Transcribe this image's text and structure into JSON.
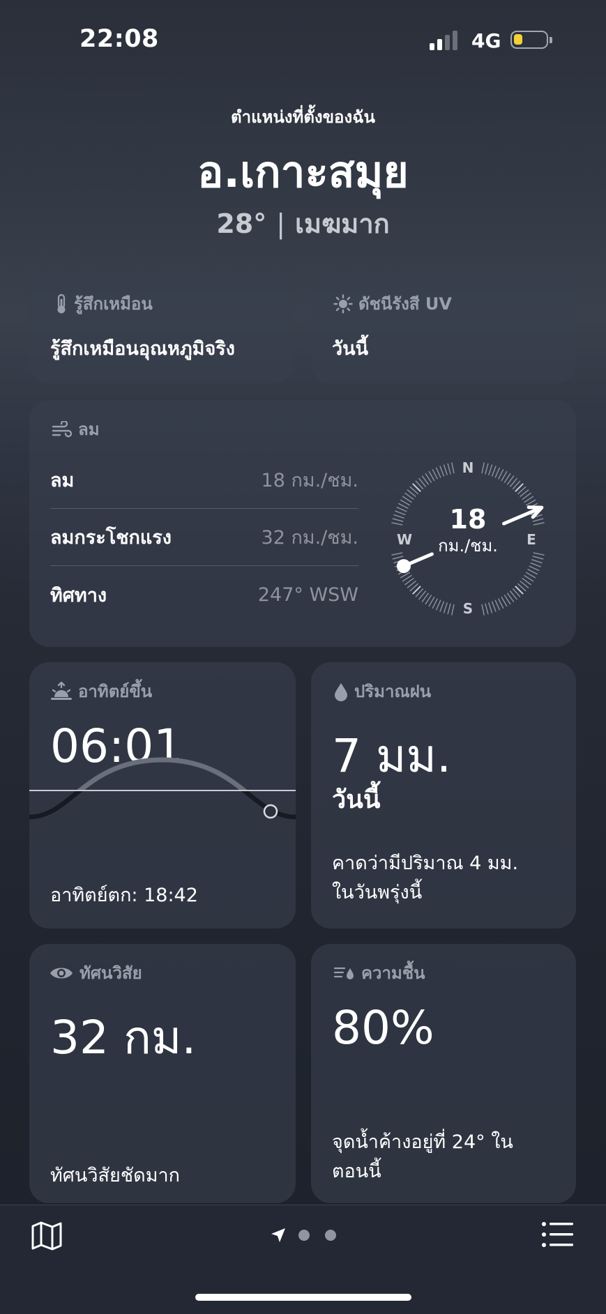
{
  "status": {
    "time": "22:08",
    "network": "4G"
  },
  "location": {
    "label": "ตำแหน่งที่ตั้งของฉัน",
    "city": "อ.เกาะสมุย",
    "temp": "28°",
    "condition": "เมฆมาก"
  },
  "feels_like": {
    "title": "รู้สึกเหมือน",
    "text": "รู้สึกเหมือนอุณหภูมิจริง"
  },
  "uv": {
    "title": "ดัชนีรังสี UV",
    "text": "วันนี้"
  },
  "wind": {
    "title": "ลม",
    "rows": [
      {
        "label": "ลม",
        "value": "18 กม./ชม."
      },
      {
        "label": "ลมกระโชกแรง",
        "value": "32 กม./ชม."
      },
      {
        "label": "ทิศทาง",
        "value": "247° WSW"
      }
    ],
    "compass": {
      "speed": "18",
      "unit": "กม./ชม.",
      "n": "N",
      "e": "E",
      "s": "S",
      "w": "W",
      "direction_deg": 247
    }
  },
  "sunrise": {
    "title": "อาทิตย์ขึ้น",
    "time": "06:01",
    "sunset": "อาทิตย์ตก: 18:42"
  },
  "precip": {
    "title": "ปริมาณฝน",
    "amount": "7 มม.",
    "period": "วันนี้",
    "forecast_line1": "คาดว่ามีปริมาณ 4 มม.",
    "forecast_line2": "ในวันพรุ่งนี้"
  },
  "visibility": {
    "title": "ทัศนวิสัย",
    "value": "32 กม.",
    "desc": "ทัศนวิสัยชัดมาก"
  },
  "humidity": {
    "title": "ความชื้น",
    "value": "80%",
    "desc_line1": "จุดน้ำค้างอยู่ที่ 24° ใน",
    "desc_line2": "ตอนนี้"
  },
  "tabbar": {
    "icons": [
      "map-icon",
      "location-arrow-icon",
      "list-icon"
    ],
    "pages": 3,
    "active_page": 0
  }
}
